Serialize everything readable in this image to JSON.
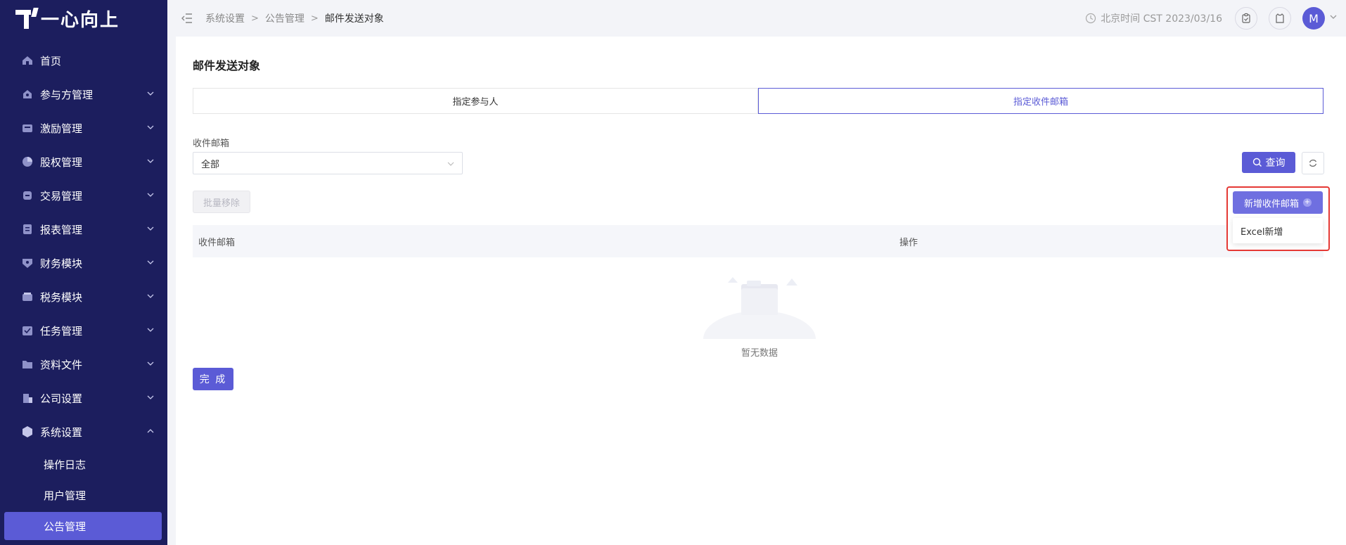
{
  "brand": {
    "name": "一心向上"
  },
  "sidebar": {
    "items": [
      {
        "label": "首页",
        "icon": "home-icon",
        "has_children": false
      },
      {
        "label": "参与方管理",
        "icon": "participants-icon",
        "has_children": true
      },
      {
        "label": "激励管理",
        "icon": "incentive-icon",
        "has_children": true
      },
      {
        "label": "股权管理",
        "icon": "equity-icon",
        "has_children": true
      },
      {
        "label": "交易管理",
        "icon": "trade-icon",
        "has_children": true
      },
      {
        "label": "报表管理",
        "icon": "report-icon",
        "has_children": true
      },
      {
        "label": "财务模块",
        "icon": "finance-icon",
        "has_children": true
      },
      {
        "label": "税务模块",
        "icon": "tax-icon",
        "has_children": true
      },
      {
        "label": "任务管理",
        "icon": "task-icon",
        "has_children": true
      },
      {
        "label": "资料文件",
        "icon": "files-icon",
        "has_children": true
      },
      {
        "label": "公司设置",
        "icon": "company-icon",
        "has_children": true
      },
      {
        "label": "系统设置",
        "icon": "system-icon",
        "has_children": true,
        "expanded": true
      }
    ],
    "subitems": [
      {
        "label": "操作日志",
        "active": false
      },
      {
        "label": "用户管理",
        "active": false
      },
      {
        "label": "公告管理",
        "active": true
      }
    ]
  },
  "header": {
    "breadcrumb": [
      "系统设置",
      "公告管理",
      "邮件发送对象"
    ],
    "time": "北京时间 CST 2023/03/16",
    "avatar": "M"
  },
  "page": {
    "title": "邮件发送对象",
    "tabs": [
      {
        "label": "指定参与人",
        "active": false
      },
      {
        "label": "指定收件邮箱",
        "active": true
      }
    ],
    "filter": {
      "label": "收件邮箱",
      "value": "全部"
    },
    "query_label": "查询",
    "batch_remove_label": "批量移除",
    "table": {
      "columns": [
        "收件邮箱",
        "操作"
      ],
      "empty_text": "暂无数据"
    },
    "done_label": "完 成",
    "add_button_label": "新增收件邮箱",
    "dropdown_options": [
      "Excel新增"
    ]
  },
  "colors": {
    "sidebar_bg": "#1c1e5e",
    "accent": "#5b5bd6",
    "highlight": "#e53935"
  }
}
